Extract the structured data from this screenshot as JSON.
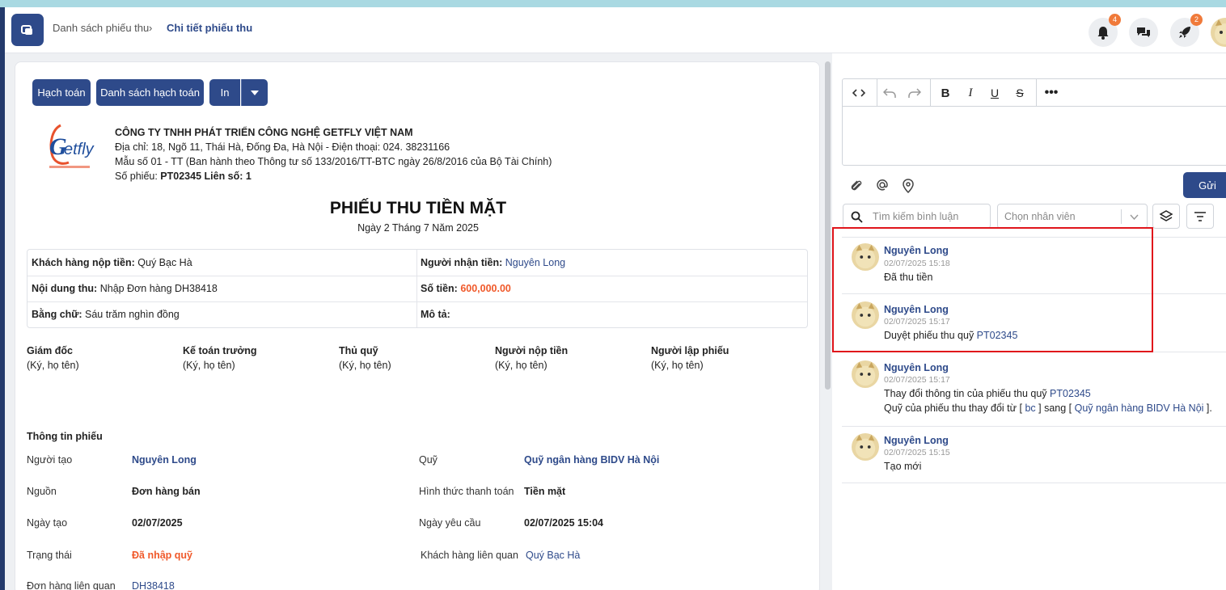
{
  "header": {
    "breadcrumb": [
      "Danh sách phiếu thu",
      "Chi tiết phiếu thu"
    ],
    "notifications_badge": "4",
    "rocket_badge": "2"
  },
  "toolbar": {
    "buttons": [
      "Hạch toán",
      "Danh sách hạch toán",
      "In"
    ]
  },
  "company": {
    "name": "CÔNG TY TNHH PHÁT TRIỂN CÔNG NGHỆ GETFLY VIỆT NAM",
    "address": "Địa chỉ: 18, Ngõ 11, Thái Hà, Đống Đa, Hà Nội - Điện thoại: 024. 38231166",
    "form": "Mẫu số 01 - TT (Ban hành theo Thông tư số 133/2016/TT-BTC ngày 26/8/2016 của Bộ Tài Chính)",
    "receipt_label": "Số phiếu: ",
    "receipt_value": "PT02345 Liên số: 1"
  },
  "receipt": {
    "title": "PHIẾU THU TIỀN MẶT",
    "date": "Ngày 2 Tháng 7 Năm 2025",
    "customer_label": "Khách hàng nộp tiền:",
    "customer_value": "Quý Bạc Hà",
    "receiver_label": "Người nhận tiền:",
    "receiver_value": "Nguyên Long",
    "content_label": "Nội dung thu:",
    "content_value": "Nhập Đơn hàng DH38418",
    "amount_label": "Số tiền:",
    "amount_value": "600,000.00",
    "words_label": "Bằng chữ:",
    "words_value": "Sáu trăm nghìn đồng",
    "desc_label": "Mô tả:"
  },
  "signatures": [
    {
      "role": "Giám đốc",
      "note": "(Ký, họ tên)"
    },
    {
      "role": "Kế toán trưởng",
      "note": "(Ký, họ tên)"
    },
    {
      "role": "Thủ quỹ",
      "note": "(Ký, họ tên)"
    },
    {
      "role": "Người nộp tiền",
      "note": "(Ký, họ tên)"
    },
    {
      "role": "Người lập phiếu",
      "note": "(Ký, họ tên)"
    }
  ],
  "details": {
    "section_title": "Thông tin phiếu",
    "creator_label": "Người tạo",
    "creator_value": "Nguyên Long",
    "fund_label": "Quỹ",
    "fund_value": "Quỹ ngân hàng BIDV Hà Nội",
    "source_label": "Nguồn",
    "source_value": "Đơn hàng bán",
    "payment_label": "Hình thức thanh toán",
    "payment_value": "Tiền mặt",
    "created_label": "Ngày tạo",
    "created_value": "02/07/2025",
    "request_label": "Ngày yêu cầu",
    "request_value": "02/07/2025 15:04",
    "status_label": "Trạng thái",
    "status_value": "Đã nhập quỹ",
    "related_customer_label": "Khách hàng liên quan",
    "related_customer_value": "Quý Bạc Hà",
    "related_order_label": "Đơn hàng liên quan",
    "related_order_value": "DH38418"
  },
  "comments_panel": {
    "send_label": "Gửi",
    "search_placeholder": "Tìm kiếm bình luận",
    "employee_placeholder": "Chọn nhân viên",
    "comments": [
      {
        "name": "Nguyên Long",
        "time": "02/07/2025 15:18",
        "text": "Đã thu tiền"
      },
      {
        "name": "Nguyên Long",
        "time": "02/07/2025 15:17",
        "text": "Duyệt phiếu thu quỹ ",
        "link": "PT02345"
      },
      {
        "name": "Nguyên Long",
        "time": "02/07/2025 15:17",
        "text": "Thay đổi thông tin của phiếu thu quỹ ",
        "link": "PT02345",
        "line2_pre": "Quỹ của phiếu thu thay đổi từ [ ",
        "line2_from": "bc",
        "line2_mid": " ] sang [ ",
        "line2_to": "Quỹ ngân hàng BIDV Hà Nội",
        "line2_post": " ]."
      },
      {
        "name": "Nguyên Long",
        "time": "02/07/2025 15:15",
        "text": "Tạo mới"
      }
    ]
  }
}
